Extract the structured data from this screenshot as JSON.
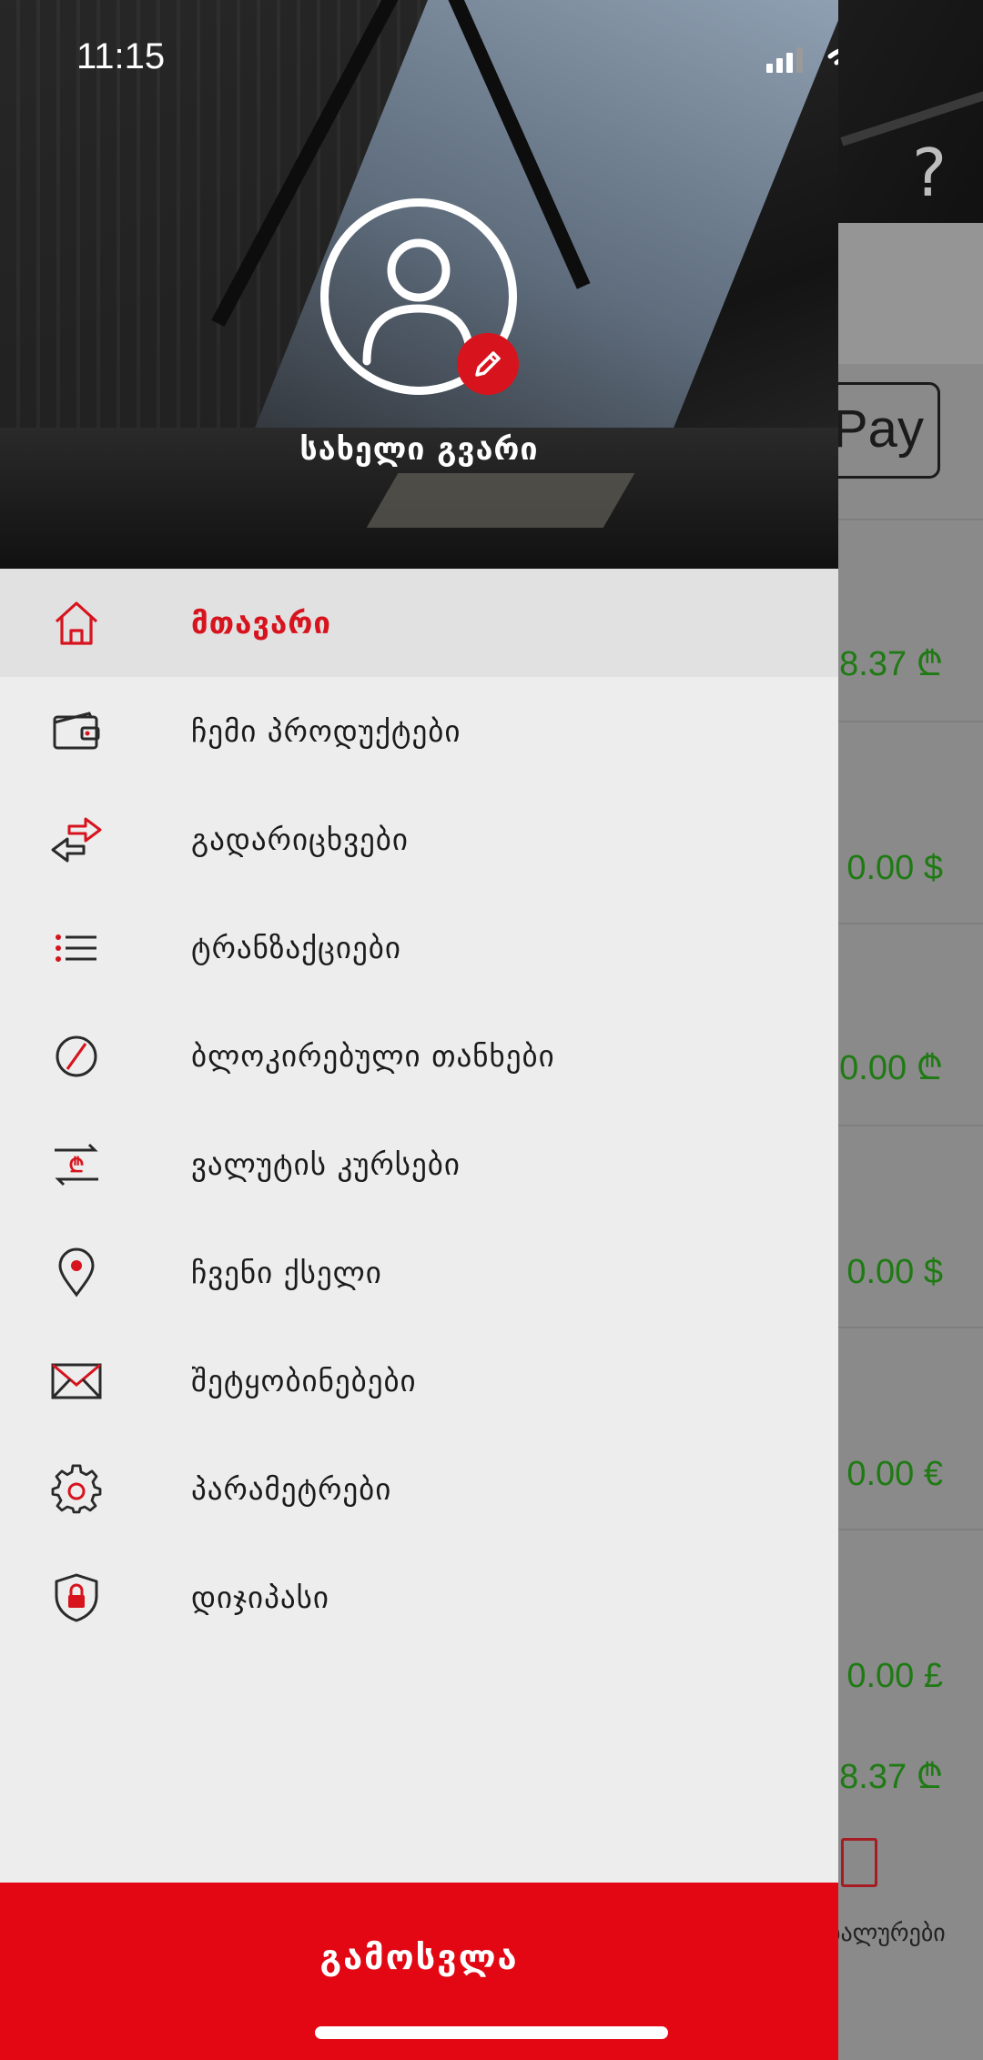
{
  "status_bar": {
    "time": "11:15"
  },
  "background": {
    "help_label": "?",
    "pay_label": "Pay",
    "amounts": [
      "8.37 ₾",
      "0.00 $",
      "0.00 ₾",
      "0.00 $",
      "0.00 €",
      "0.00 £"
    ],
    "total": "8.37 ₾",
    "bottom_tab_label": "ბალურები"
  },
  "profile": {
    "name": "სახელი გვარი"
  },
  "menu": [
    {
      "label": "მთავარი",
      "icon": "home-icon",
      "active": true
    },
    {
      "label": "ჩემი პროდუქტები",
      "icon": "wallet-icon"
    },
    {
      "label": "გადარიცხვები",
      "icon": "transfer-arrows-icon"
    },
    {
      "label": "ტრანზაქციები",
      "icon": "list-icon"
    },
    {
      "label": "ბლოკირებული თანხები",
      "icon": "blocked-icon"
    },
    {
      "label": "ვალუტის კურსები",
      "icon": "currency-exchange-icon"
    },
    {
      "label": "ჩვენი ქსელი",
      "icon": "location-pin-icon"
    },
    {
      "label": "შეტყობინებები",
      "icon": "envelope-icon"
    },
    {
      "label": "პარამეტრები",
      "icon": "gear-icon"
    },
    {
      "label": "დიჯიპასი",
      "icon": "shield-lock-icon"
    }
  ],
  "logout": {
    "label": "გამოსვლა"
  },
  "colors": {
    "accent": "#d7141e",
    "logout_bg": "#e30613",
    "amount_green": "#1f7a14",
    "menu_bg": "#ededed",
    "active_row": "#e1e1e1"
  }
}
